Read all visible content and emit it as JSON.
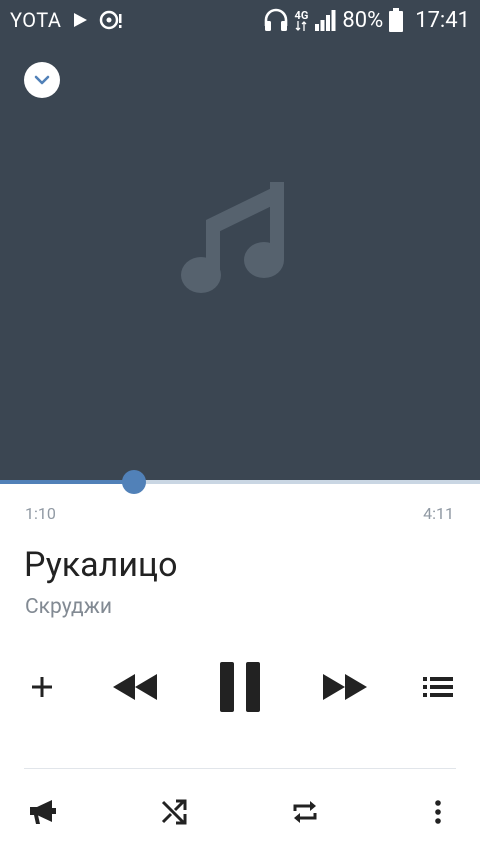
{
  "status_bar": {
    "carrier": "YOTA",
    "network_type": "4G",
    "battery": "80%",
    "time": "17:41",
    "icons": [
      "play-icon",
      "media-icon",
      "headphones-icon",
      "signal-icon",
      "battery-icon"
    ]
  },
  "player": {
    "artwork_icon": "music-note-icon",
    "collapse_icon": "chevron-down-icon",
    "progress": {
      "elapsed": "1:10",
      "total": "4:11",
      "fraction": 0.279
    },
    "track": {
      "title": "Рукалицо",
      "artist": "Скруджи"
    }
  },
  "controls": {
    "icons": [
      "add-icon",
      "previous-icon",
      "pause-icon",
      "next-icon",
      "playlist-icon"
    ]
  },
  "bottom_bar": {
    "icons": [
      "broadcast-icon",
      "shuffle-icon",
      "repeat-icon",
      "more-icon"
    ]
  },
  "colors": {
    "header_bg": "#3b4652",
    "accent": "#5181b8",
    "track": "#c9d6e3",
    "text_primary": "#222222",
    "text_secondary": "#828a93"
  }
}
